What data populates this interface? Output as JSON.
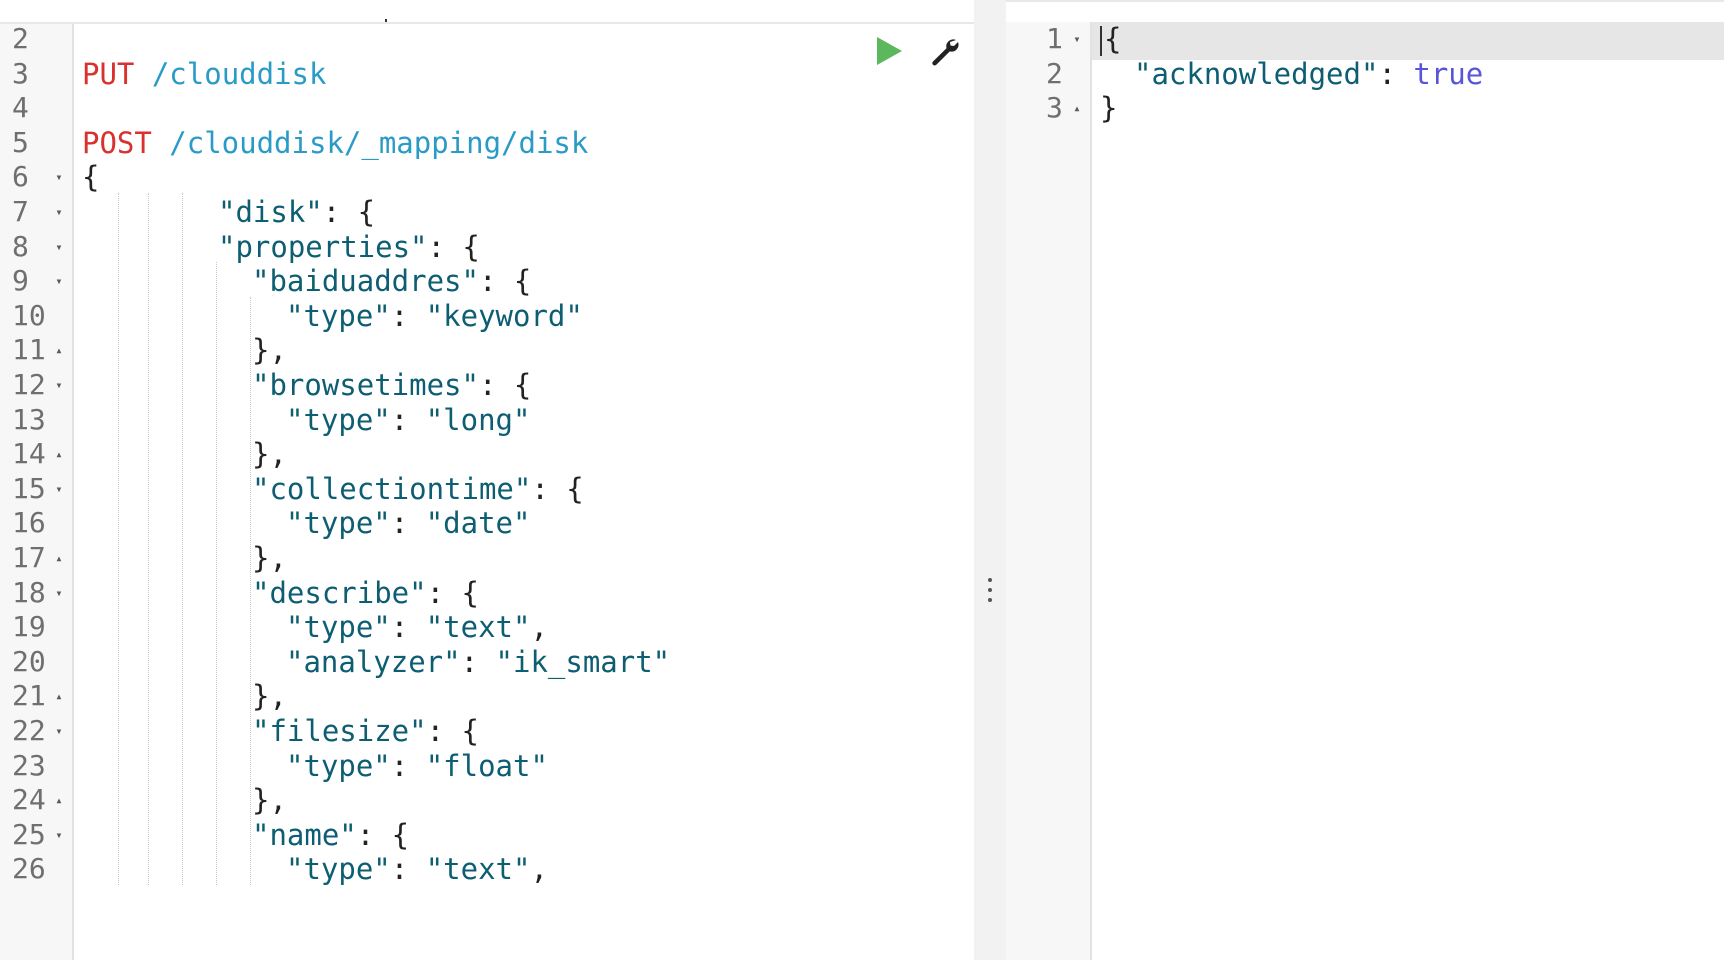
{
  "editor": {
    "gutter": [
      {
        "num": "2",
        "fold": ""
      },
      {
        "num": "3",
        "fold": ""
      },
      {
        "num": "4",
        "fold": ""
      },
      {
        "num": "5",
        "fold": ""
      },
      {
        "num": "6",
        "fold": "▾"
      },
      {
        "num": "7",
        "fold": "▾"
      },
      {
        "num": "8",
        "fold": "▾"
      },
      {
        "num": "9",
        "fold": "▾"
      },
      {
        "num": "10",
        "fold": ""
      },
      {
        "num": "11",
        "fold": "▴"
      },
      {
        "num": "12",
        "fold": "▾"
      },
      {
        "num": "13",
        "fold": ""
      },
      {
        "num": "14",
        "fold": "▴"
      },
      {
        "num": "15",
        "fold": "▾"
      },
      {
        "num": "16",
        "fold": ""
      },
      {
        "num": "17",
        "fold": "▴"
      },
      {
        "num": "18",
        "fold": "▾"
      },
      {
        "num": "19",
        "fold": ""
      },
      {
        "num": "20",
        "fold": ""
      },
      {
        "num": "21",
        "fold": "▴"
      },
      {
        "num": "22",
        "fold": "▾"
      },
      {
        "num": "23",
        "fold": ""
      },
      {
        "num": "24",
        "fold": "▴"
      },
      {
        "num": "25",
        "fold": "▾"
      },
      {
        "num": "26",
        "fold": ""
      }
    ],
    "lines": [
      {
        "indent": 0,
        "parts": []
      },
      {
        "indent": 0,
        "parts": [
          {
            "t": "PUT",
            "c": "method"
          },
          {
            "t": " /clouddisk",
            "c": "path"
          }
        ]
      },
      {
        "indent": 0,
        "parts": []
      },
      {
        "indent": 0,
        "parts": [
          {
            "t": "POST",
            "c": "method"
          },
          {
            "t": " /clouddisk/_mapping/disk",
            "c": "path"
          }
        ]
      },
      {
        "indent": 0,
        "parts": [
          {
            "t": "{",
            "c": "punct"
          }
        ]
      },
      {
        "indent": 4,
        "parts": [
          {
            "t": "\"disk\"",
            "c": "key"
          },
          {
            "t": ": {",
            "c": "punct"
          }
        ]
      },
      {
        "indent": 4,
        "parts": [
          {
            "t": "\"properties\"",
            "c": "key"
          },
          {
            "t": ": {",
            "c": "punct"
          }
        ]
      },
      {
        "indent": 5,
        "parts": [
          {
            "t": "\"baiduaddres\"",
            "c": "key"
          },
          {
            "t": ": {",
            "c": "punct"
          }
        ]
      },
      {
        "indent": 6,
        "parts": [
          {
            "t": "\"type\"",
            "c": "key"
          },
          {
            "t": ": ",
            "c": "punct"
          },
          {
            "t": "\"keyword\"",
            "c": "str"
          }
        ]
      },
      {
        "indent": 5,
        "parts": [
          {
            "t": "},",
            "c": "punct"
          }
        ]
      },
      {
        "indent": 5,
        "parts": [
          {
            "t": "\"browsetimes\"",
            "c": "key"
          },
          {
            "t": ": {",
            "c": "punct"
          }
        ]
      },
      {
        "indent": 6,
        "parts": [
          {
            "t": "\"type\"",
            "c": "key"
          },
          {
            "t": ": ",
            "c": "punct"
          },
          {
            "t": "\"long\"",
            "c": "str"
          }
        ]
      },
      {
        "indent": 5,
        "parts": [
          {
            "t": "},",
            "c": "punct"
          }
        ]
      },
      {
        "indent": 5,
        "parts": [
          {
            "t": "\"collectiontime\"",
            "c": "key"
          },
          {
            "t": ": {",
            "c": "punct"
          }
        ]
      },
      {
        "indent": 6,
        "parts": [
          {
            "t": "\"type\"",
            "c": "key"
          },
          {
            "t": ": ",
            "c": "punct"
          },
          {
            "t": "\"date\"",
            "c": "str"
          }
        ]
      },
      {
        "indent": 5,
        "parts": [
          {
            "t": "},",
            "c": "punct"
          }
        ]
      },
      {
        "indent": 5,
        "parts": [
          {
            "t": "\"describe\"",
            "c": "key"
          },
          {
            "t": ": {",
            "c": "punct"
          }
        ]
      },
      {
        "indent": 6,
        "parts": [
          {
            "t": "\"type\"",
            "c": "key"
          },
          {
            "t": ": ",
            "c": "punct"
          },
          {
            "t": "\"text\"",
            "c": "str"
          },
          {
            "t": ",",
            "c": "punct"
          }
        ]
      },
      {
        "indent": 6,
        "parts": [
          {
            "t": "\"analyzer\"",
            "c": "key"
          },
          {
            "t": ": ",
            "c": "punct"
          },
          {
            "t": "\"ik_smart\"",
            "c": "str"
          }
        ]
      },
      {
        "indent": 5,
        "parts": [
          {
            "t": "},",
            "c": "punct"
          }
        ]
      },
      {
        "indent": 5,
        "parts": [
          {
            "t": "\"filesize\"",
            "c": "key"
          },
          {
            "t": ": {",
            "c": "punct"
          }
        ]
      },
      {
        "indent": 6,
        "parts": [
          {
            "t": "\"type\"",
            "c": "key"
          },
          {
            "t": ": ",
            "c": "punct"
          },
          {
            "t": "\"float\"",
            "c": "str"
          }
        ]
      },
      {
        "indent": 5,
        "parts": [
          {
            "t": "},",
            "c": "punct"
          }
        ]
      },
      {
        "indent": 5,
        "parts": [
          {
            "t": "\"name\"",
            "c": "key"
          },
          {
            "t": ": {",
            "c": "punct"
          }
        ]
      },
      {
        "indent": 6,
        "parts": [
          {
            "t": "\"type\"",
            "c": "key"
          },
          {
            "t": ": ",
            "c": "punct"
          },
          {
            "t": "\"text\"",
            "c": "str"
          },
          {
            "t": ",",
            "c": "punct"
          }
        ]
      }
    ],
    "actions": {
      "run_icon": "play-icon",
      "settings_icon": "wrench-icon",
      "run_color": "#5cb85c"
    }
  },
  "response": {
    "gutter": [
      {
        "num": "1",
        "fold": "▾"
      },
      {
        "num": "2",
        "fold": ""
      },
      {
        "num": "3",
        "fold": "▴"
      }
    ],
    "lines": [
      {
        "indent": 0,
        "parts": [
          {
            "t": "{",
            "c": "punct"
          }
        ]
      },
      {
        "indent": 1,
        "parts": [
          {
            "t": "\"acknowledged\"",
            "c": "key"
          },
          {
            "t": ": ",
            "c": "punct"
          },
          {
            "t": "true",
            "c": "bool"
          }
        ]
      },
      {
        "indent": 0,
        "parts": [
          {
            "t": "}",
            "c": "punct"
          }
        ]
      }
    ]
  },
  "colors": {
    "method": "#d9312e",
    "path": "#2a9bc7",
    "key": "#0d5e72",
    "bool": "#5a55d6",
    "gutter_bg": "#f7f7f7"
  }
}
